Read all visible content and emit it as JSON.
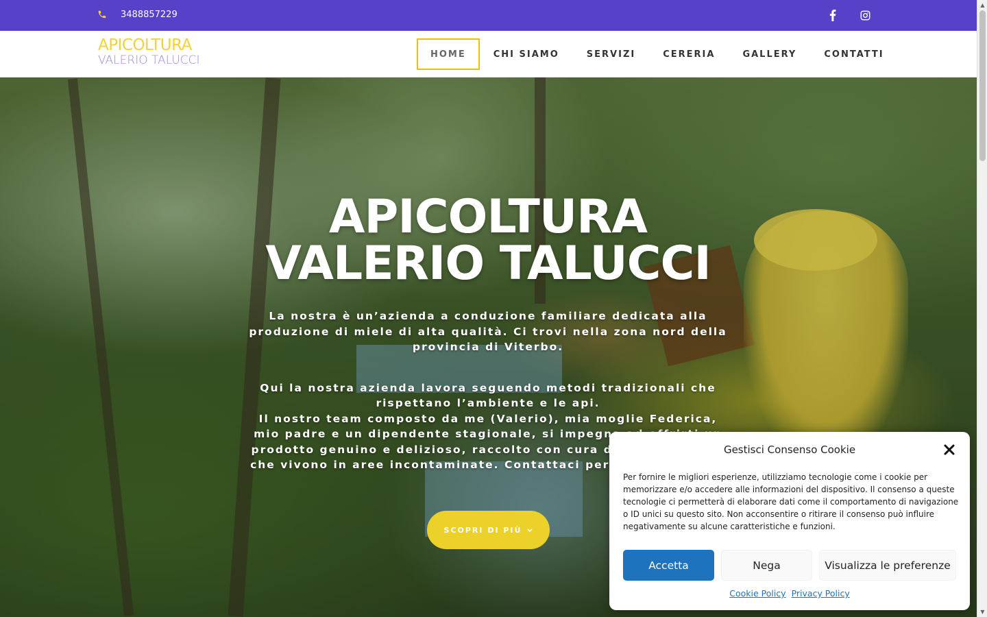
{
  "topbar": {
    "phone": "3488857229",
    "icons": [
      "phone-icon",
      "facebook-icon",
      "instagram-icon"
    ]
  },
  "header": {
    "logo_line1": "APICOLTURA",
    "logo_line2": "VALERIO TALUCCI",
    "nav": [
      {
        "label": "HOME",
        "active": true
      },
      {
        "label": "CHI SIAMO"
      },
      {
        "label": "SERVIZI"
      },
      {
        "label": "CERERIA"
      },
      {
        "label": "GALLERY"
      },
      {
        "label": "CONTATTI"
      }
    ]
  },
  "hero": {
    "title_line1": "APICOLTURA",
    "title_line2": "VALERIO TALUCCI",
    "paragraph1": "La nostra è un’azienda a conduzione familiare dedicata alla produzione di miele di alta qualità. Ci trovi nella zona nord della provincia di Viterbo.",
    "paragraph2a": "Qui la nostra azienda lavora seguendo metodi tradizionali che rispettano l’ambiente e le api.",
    "paragraph2b": "Il nostro team composto da me (Valerio), mia moglie Federica, mio padre e un dipendente stagionale, si impegna ad offrirti un prodotto genuino e delizioso, raccolto con cura dalle nostre api, che vivono in aree incontaminate. Contattaci per saperne di più!",
    "cta_label": "SCOPRI DI PIÙ"
  },
  "cookie": {
    "title": "Gestisci Consenso Cookie",
    "body": "Per fornire le migliori esperienze, utilizziamo tecnologie come i cookie per memorizzare e/o accedere alle informazioni del dispositivo. Il consenso a queste tecnologie ci permetterà di elaborare dati come il comportamento di navigazione o ID unici su questo sito. Non acconsentire o ritirare il consenso può influire negativamente su alcune caratteristiche e funzioni.",
    "accept": "Accetta",
    "deny": "Nega",
    "preferences": "Visualizza le preferenze",
    "link_cookie": "Cookie Policy",
    "link_privacy": "Privacy Policy"
  },
  "colors": {
    "topbar": "#5641c8",
    "accent_yellow": "#ecd12a",
    "logo_purple": "#a487d4",
    "accept_blue": "#1e73be"
  }
}
